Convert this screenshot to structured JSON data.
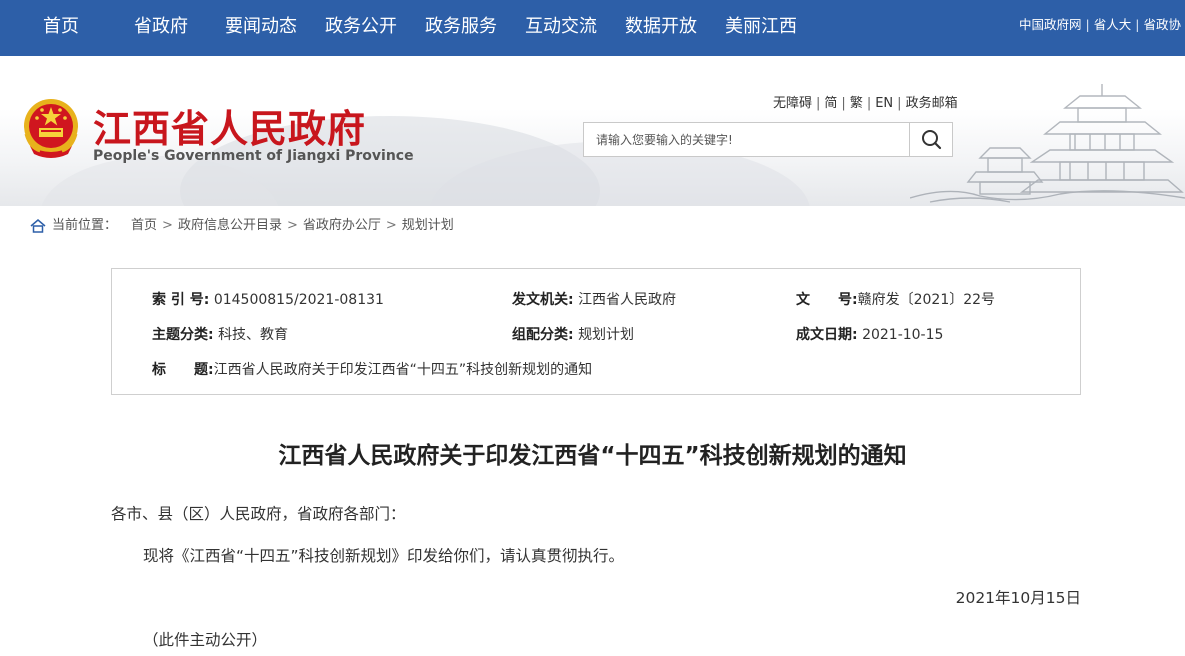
{
  "nav": {
    "items": [
      "首页",
      "省政府",
      "要闻动态",
      "政务公开",
      "政务服务",
      "互动交流",
      "数据开放",
      "美丽江西"
    ],
    "links": [
      "中国政府网",
      "省人大",
      "省政协"
    ]
  },
  "header": {
    "title": "江西省人民政府",
    "subtitle": "People's Government of Jiangxi Province",
    "tools": [
      "无障碍",
      "简",
      "繁",
      "EN",
      "政务邮箱"
    ],
    "search_placeholder": "请输入您要输入的关键字!"
  },
  "breadcrumb": {
    "label": "当前位置：",
    "items": [
      "首页",
      "政府信息公开目录",
      "省政府办公厅",
      "规划计划"
    ]
  },
  "info": {
    "index_label": "索 引 号:",
    "index_value": "014500815/2021-08131",
    "issuer_label": "发文机关:",
    "issuer_value": "江西省人民政府",
    "docno_label": "文　　号:",
    "docno_value": "赣府发〔2021〕22号",
    "topic_label": "主题分类:",
    "topic_value": "科技、教育",
    "category_label": "组配分类:",
    "category_value": "规划计划",
    "date_label": "成文日期:",
    "date_value": "2021-10-15",
    "title_label": "标　　题:",
    "title_value": "江西省人民政府关于印发江西省“十四五”科技创新规划的通知"
  },
  "article": {
    "title": "江西省人民政府关于印发江西省“十四五”科技创新规划的通知",
    "salutation": "各市、县（区）人民政府，省政府各部门：",
    "body": "现将《江西省“十四五”科技创新规划》印发给你们，请认真贯彻执行。",
    "date": "2021年10月15日",
    "note": "（此件主动公开）"
  },
  "colors": {
    "nav_bg": "#2d5fa8",
    "title_red": "#c8161d"
  }
}
